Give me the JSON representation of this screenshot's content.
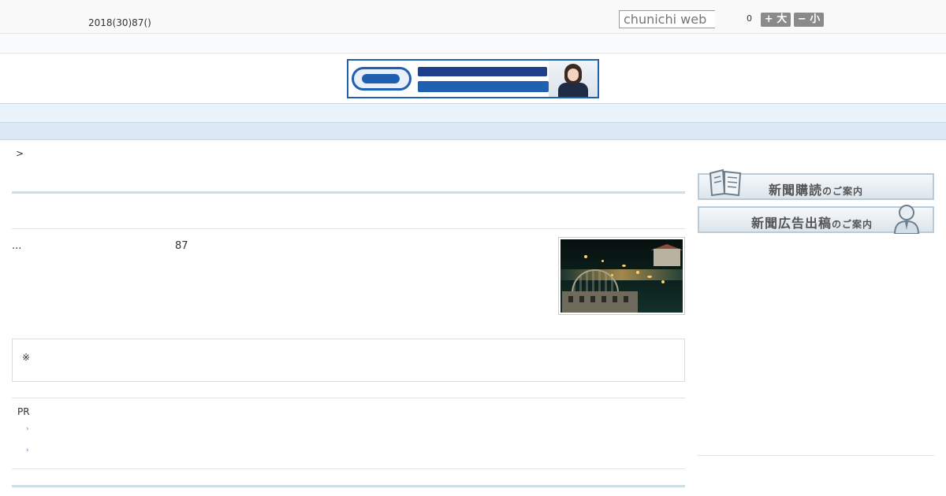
{
  "header": {
    "date": "2018(30)87()",
    "search_placeholder": "chunichi web",
    "search_count": "0",
    "font_larger": "+ 大",
    "font_smaller": "− 小"
  },
  "banner": {
    "alt": "地元の大学を探すなら、地元の進学サイトで。",
    "primary_color": "#2060b0"
  },
  "nav": {
    "items": [
      "",
      "",
      "",
      "",
      "",
      "",
      "",
      "",
      ""
    ]
  },
  "breadcrumb": ">",
  "article": {
    "lead": "...",
    "number": "87",
    "photo_icon": "atomic-bomb-dome-night-photo"
  },
  "notice": {
    "text": "※"
  },
  "pr": {
    "label": "PR",
    "links": [
      "",
      ""
    ],
    "arrow_glyph": "›"
  },
  "sidebar": {
    "subscribe": {
      "main": "新聞購読",
      "small": "のご案内",
      "icon": "newspaper-icon"
    },
    "advertise": {
      "main": "新聞広告出稿",
      "small": "のご案内",
      "icon": "businessman-icon"
    }
  }
}
